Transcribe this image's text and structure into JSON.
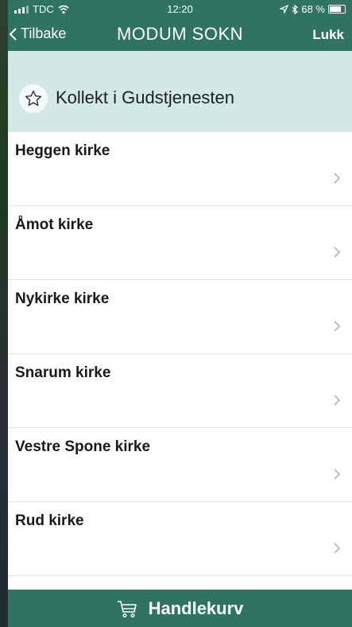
{
  "status": {
    "carrier": "TDC",
    "time": "12:20",
    "battery": "68 %",
    "battery_level": 0.68
  },
  "nav": {
    "back_label": "Tilbake",
    "title": "MODUM SOKN",
    "close_label": "Lukk"
  },
  "section": {
    "title": "Kollekt i Gudstjenesten",
    "icon": "star-outline-icon"
  },
  "list": {
    "items": [
      {
        "label": "Heggen kirke"
      },
      {
        "label": "Åmot kirke"
      },
      {
        "label": "Nykirke kirke"
      },
      {
        "label": "Snarum kirke"
      },
      {
        "label": "Vestre Spone kirke"
      },
      {
        "label": "Rud kirke"
      }
    ]
  },
  "cart": {
    "label": "Handlekurv",
    "icon": "shopping-cart-icon"
  },
  "colors": {
    "accent": "#2f7460",
    "section_bg": "#d3e9e8"
  }
}
